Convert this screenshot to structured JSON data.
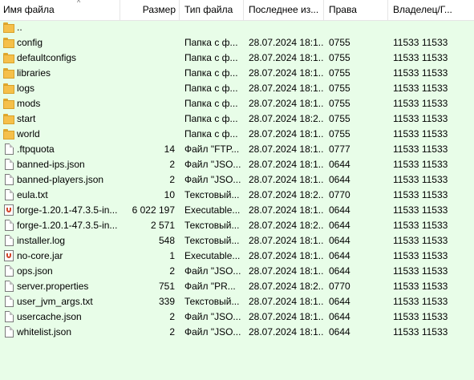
{
  "columns": {
    "name": "Имя файла",
    "size": "Размер",
    "type": "Тип файла",
    "date": "Последнее из...",
    "perms": "Права",
    "owner": "Владелец/Г..."
  },
  "rows": [
    {
      "icon": "folder-icon",
      "name": "..",
      "size": "",
      "type": "",
      "date": "",
      "perms": "",
      "owner": ""
    },
    {
      "icon": "folder-icon",
      "name": "config",
      "size": "",
      "type": "Папка с ф...",
      "date": "28.07.2024 18:1...",
      "perms": "0755",
      "owner": "11533 11533"
    },
    {
      "icon": "folder-icon",
      "name": "defaultconfigs",
      "size": "",
      "type": "Папка с ф...",
      "date": "28.07.2024 18:1...",
      "perms": "0755",
      "owner": "11533 11533"
    },
    {
      "icon": "folder-icon",
      "name": "libraries",
      "size": "",
      "type": "Папка с ф...",
      "date": "28.07.2024 18:1...",
      "perms": "0755",
      "owner": "11533 11533"
    },
    {
      "icon": "folder-icon",
      "name": "logs",
      "size": "",
      "type": "Папка с ф...",
      "date": "28.07.2024 18:1...",
      "perms": "0755",
      "owner": "11533 11533"
    },
    {
      "icon": "folder-icon",
      "name": "mods",
      "size": "",
      "type": "Папка с ф...",
      "date": "28.07.2024 18:1...",
      "perms": "0755",
      "owner": "11533 11533"
    },
    {
      "icon": "folder-icon",
      "name": "start",
      "size": "",
      "type": "Папка с ф...",
      "date": "28.07.2024 18:2...",
      "perms": "0755",
      "owner": "11533 11533"
    },
    {
      "icon": "folder-icon",
      "name": "world",
      "size": "",
      "type": "Папка с ф...",
      "date": "28.07.2024 18:1...",
      "perms": "0755",
      "owner": "11533 11533"
    },
    {
      "icon": "file-icon",
      "name": ".ftpquota",
      "size": "14",
      "type": "Файл \"FTP...",
      "date": "28.07.2024 18:1...",
      "perms": "0777",
      "owner": "11533 11533"
    },
    {
      "icon": "file-icon",
      "name": "banned-ips.json",
      "size": "2",
      "type": "Файл \"JSO...",
      "date": "28.07.2024 18:1...",
      "perms": "0644",
      "owner": "11533 11533"
    },
    {
      "icon": "file-icon",
      "name": "banned-players.json",
      "size": "2",
      "type": "Файл \"JSO...",
      "date": "28.07.2024 18:1...",
      "perms": "0644",
      "owner": "11533 11533"
    },
    {
      "icon": "file-icon",
      "name": "eula.txt",
      "size": "10",
      "type": "Текстовый...",
      "date": "28.07.2024 18:2...",
      "perms": "0770",
      "owner": "11533 11533"
    },
    {
      "icon": "java-icon",
      "name": "forge-1.20.1-47.3.5-in...",
      "size": "6 022 197",
      "type": "Executable...",
      "date": "28.07.2024 18:1...",
      "perms": "0644",
      "owner": "11533 11533"
    },
    {
      "icon": "file-icon",
      "name": "forge-1.20.1-47.3.5-in...",
      "size": "2 571",
      "type": "Текстовый...",
      "date": "28.07.2024 18:2...",
      "perms": "0644",
      "owner": "11533 11533"
    },
    {
      "icon": "file-icon",
      "name": "installer.log",
      "size": "548",
      "type": "Текстовый...",
      "date": "28.07.2024 18:1...",
      "perms": "0644",
      "owner": "11533 11533"
    },
    {
      "icon": "java-icon",
      "name": "no-core.jar",
      "size": "1",
      "type": "Executable...",
      "date": "28.07.2024 18:1...",
      "perms": "0644",
      "owner": "11533 11533"
    },
    {
      "icon": "file-icon",
      "name": "ops.json",
      "size": "2",
      "type": "Файл \"JSO...",
      "date": "28.07.2024 18:1...",
      "perms": "0644",
      "owner": "11533 11533"
    },
    {
      "icon": "file-icon",
      "name": "server.properties",
      "size": "751",
      "type": "Файл \"PR...",
      "date": "28.07.2024 18:2...",
      "perms": "0770",
      "owner": "11533 11533"
    },
    {
      "icon": "file-icon",
      "name": "user_jvm_args.txt",
      "size": "339",
      "type": "Текстовый...",
      "date": "28.07.2024 18:1...",
      "perms": "0644",
      "owner": "11533 11533"
    },
    {
      "icon": "file-icon",
      "name": "usercache.json",
      "size": "2",
      "type": "Файл \"JSO...",
      "date": "28.07.2024 18:1...",
      "perms": "0644",
      "owner": "11533 11533"
    },
    {
      "icon": "file-icon",
      "name": "whitelist.json",
      "size": "2",
      "type": "Файл \"JSO...",
      "date": "28.07.2024 18:1...",
      "perms": "0644",
      "owner": "11533 11533"
    }
  ]
}
